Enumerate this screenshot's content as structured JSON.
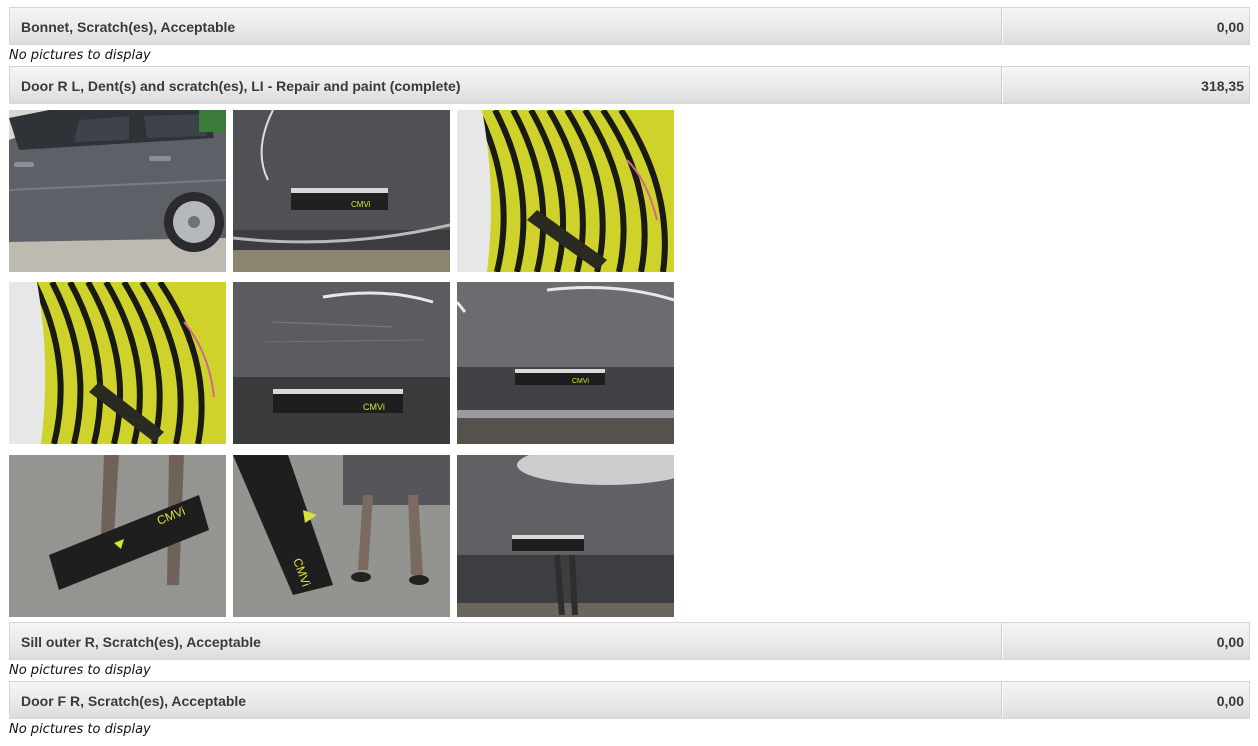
{
  "sections": [
    {
      "title": "Bonnet, Scratch(es), Acceptable",
      "amount": "0,00",
      "pictures_note": "No pictures to display"
    },
    {
      "title": "Door R L, Dent(s) and scratch(es), LI - Repair and paint (complete)",
      "amount": "318,35"
    },
    {
      "title": "Sill outer R, Scratch(es), Acceptable",
      "amount": "0,00",
      "pictures_note": "No pictures to display"
    },
    {
      "title": "Door F R, Scratch(es), Acceptable",
      "amount": "0,00",
      "pictures_note": "No pictures to display"
    }
  ],
  "gallery": {
    "photos": [
      {
        "subject": "car-side-view"
      },
      {
        "subject": "door-with-ruler"
      },
      {
        "subject": "yellow-stripe-reflection"
      },
      {
        "subject": "yellow-stripe-reflection"
      },
      {
        "subject": "door-scratch-with-ruler"
      },
      {
        "subject": "door-lower-with-ruler"
      },
      {
        "subject": "tilted-ruler-reflection"
      },
      {
        "subject": "vertical-ruler-reflection"
      },
      {
        "subject": "door-dark-with-ruler"
      }
    ]
  }
}
